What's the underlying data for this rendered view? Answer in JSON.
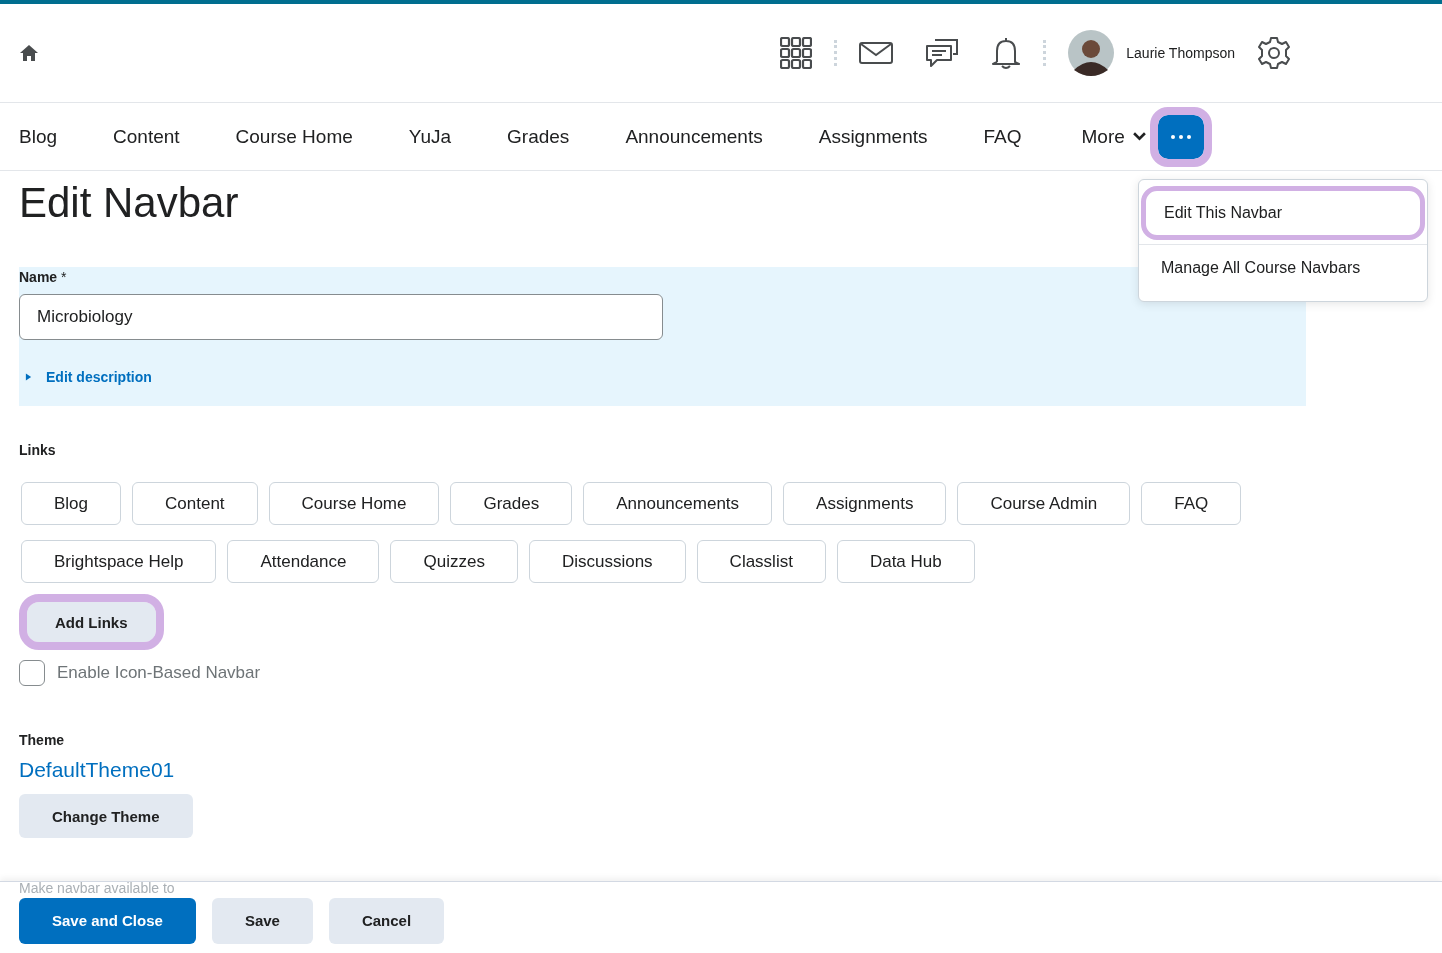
{
  "header": {
    "user_name": "Laurie Thompson"
  },
  "navbar": {
    "items": [
      {
        "label": "Blog"
      },
      {
        "label": "Content"
      },
      {
        "label": "Course Home"
      },
      {
        "label": "YuJa"
      },
      {
        "label": "Grades"
      },
      {
        "label": "Announcements"
      },
      {
        "label": "Assignments"
      },
      {
        "label": "FAQ"
      }
    ],
    "more_label": "More",
    "options_button": {
      "highlighted": true
    }
  },
  "menu": {
    "items": [
      {
        "label": "Edit This Navbar",
        "highlighted": true
      },
      {
        "label": "Manage All Course Navbars",
        "highlighted": false
      }
    ]
  },
  "page_title": "Edit Navbar",
  "name_field": {
    "label": "Name",
    "required_mark": "*",
    "value": "Microbiology"
  },
  "edit_description": {
    "label": "Edit description",
    "expanded": false
  },
  "links": {
    "label": "Links",
    "items": [
      {
        "label": "Blog"
      },
      {
        "label": "Content"
      },
      {
        "label": "Course Home"
      },
      {
        "label": "Grades"
      },
      {
        "label": "Announcements"
      },
      {
        "label": "Assignments"
      },
      {
        "label": "Course Admin"
      },
      {
        "label": "FAQ"
      },
      {
        "label": "Brightspace Help"
      },
      {
        "label": "Attendance"
      },
      {
        "label": "Quizzes"
      },
      {
        "label": "Discussions"
      },
      {
        "label": "Classlist"
      },
      {
        "label": "Data Hub"
      }
    ],
    "add_button": {
      "label": "Add Links",
      "highlighted": true
    }
  },
  "icon_navbar": {
    "label": "Enable Icon-Based Navbar",
    "checked": false
  },
  "theme": {
    "label": "Theme",
    "value": "DefaultTheme01",
    "button": "Change Theme"
  },
  "availability_label": "Make navbar available to",
  "footer": {
    "buttons": [
      {
        "label": "Save and Close",
        "kind": "primary"
      },
      {
        "label": "Save",
        "kind": "secondary"
      },
      {
        "label": "Cancel",
        "kind": "secondary"
      }
    ]
  }
}
